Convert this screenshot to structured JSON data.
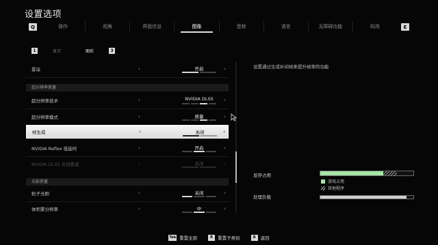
{
  "title": "设置选项",
  "tabbar": {
    "left_key": "Q",
    "right_key": "E",
    "tabs": [
      {
        "label": "操作",
        "active": false
      },
      {
        "label": "视角",
        "active": false
      },
      {
        "label": "界面信息",
        "active": false
      },
      {
        "label": "图像",
        "active": true
      },
      {
        "label": "音频",
        "active": false
      },
      {
        "label": "语言",
        "active": false
      },
      {
        "label": "无障碍功能",
        "active": false
      },
      {
        "label": "码场",
        "active": false
      }
    ]
  },
  "subtabs": {
    "left_key": "1",
    "right_key": "3",
    "items": [
      {
        "label": "显示",
        "active": false
      },
      {
        "label": "图形",
        "active": true
      }
    ]
  },
  "settings": {
    "row_top": {
      "label": "景深",
      "value": "开启",
      "dots": [
        1,
        0
      ]
    },
    "section_upscale": "超分辨率质量",
    "row_tech": {
      "label": "超分辨率技术",
      "value": "NVIDIA DLSS",
      "dots": [
        0,
        0,
        1,
        0
      ]
    },
    "row_mode": {
      "label": "超分辨率模式",
      "value": "质量",
      "dots": [
        0,
        0,
        1,
        0
      ]
    },
    "row_framegen": {
      "label": "帧生成",
      "value": "关闭",
      "dots": [
        1,
        0
      ]
    },
    "row_reflex": {
      "label": "NVIDIA Reflex 低延时",
      "value": "开启",
      "dots": [
        0,
        1,
        0
      ]
    },
    "row_dlss_sharp": {
      "label": "NVIDIA DLSS 光线重建",
      "value": "关闭",
      "dots": [
        1,
        0
      ]
    },
    "section_light": "光影质量",
    "row_particle": {
      "label": "粒子光照",
      "value": "关闭",
      "dots": [
        1,
        0,
        0
      ]
    },
    "row_volume": {
      "label": "体积雾分辨率",
      "value": "中",
      "dots": [
        0,
        1,
        0
      ]
    }
  },
  "description": "设置通过生成补间帧来提升帧率的功能",
  "memory": {
    "vram_label": "显存占用",
    "legend_game": "游戏占用",
    "legend_other": "其他程序",
    "load_label": "处理负载",
    "vram_game_fraction": 0.68,
    "vram_other_fraction": 0.14,
    "load_fraction": 0.93
  },
  "footer": [
    {
      "key": "Tab",
      "label": "重置全部"
    },
    {
      "key": "R",
      "label": "重置子类别"
    },
    {
      "key": "B",
      "label": "返回"
    }
  ],
  "colors": {
    "accent_green": "#a6e6a6",
    "selected_row": "#e6e6e6"
  }
}
